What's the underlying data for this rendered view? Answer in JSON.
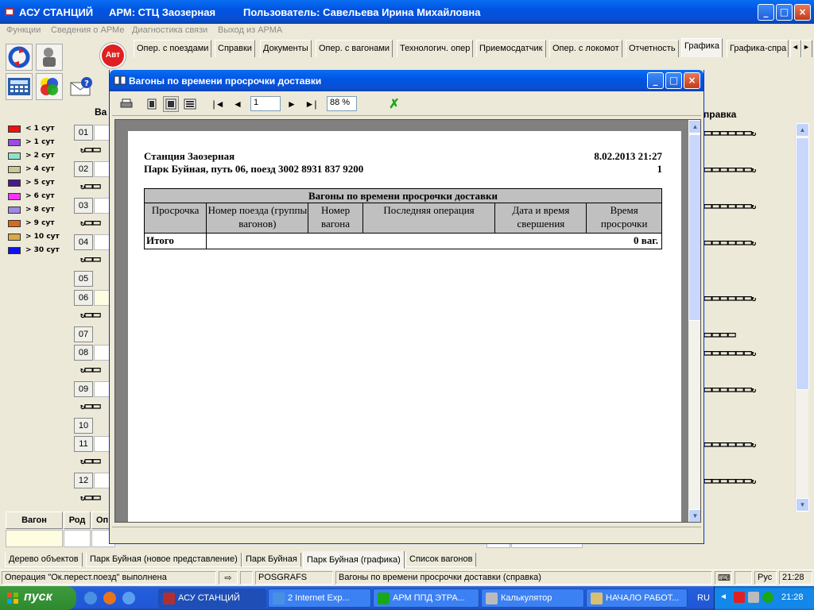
{
  "window": {
    "app_title": "АСУ СТАНЦИЙ",
    "arm_title": "АРМ: СТЦ Заозерная",
    "user_title": "Пользователь: Савельева Ирина Михайловна"
  },
  "menu": [
    "Функции",
    "Сведения о АРМе",
    "Диагностика связи",
    "Выход из АРМА"
  ],
  "tabs": [
    "Опер. с поездами",
    "Справки",
    "Документы",
    "Опер. с вагонами",
    "Технологич. опер",
    "Приемосдатчик",
    "Опер. с локомот",
    "Отчетность",
    "Графика",
    "Графика-спра"
  ],
  "tabs_active": "Графика",
  "icon_avt": "Авт",
  "legend": [
    {
      "label": "< 1 сут",
      "color": "#ee1111"
    },
    {
      "label": "> 1 сут",
      "color": "#9a4be0"
    },
    {
      "label": "> 2 сут",
      "color": "#8fe3c8"
    },
    {
      "label": "> 4 сут",
      "color": "#c8c890"
    },
    {
      "label": "> 5 сут",
      "color": "#4b1a8a"
    },
    {
      "label": "> 6 сут",
      "color": "#ff33ff"
    },
    {
      "label": "> 8 сут",
      "color": "#9a8ae0"
    },
    {
      "label": "> 9 сут",
      "color": "#d86a1a"
    },
    {
      "label": "> 10 сут",
      "color": "#d8a84a"
    },
    {
      "label": "> 30 сут",
      "color": "#1010ee"
    }
  ],
  "tracks": [
    "01",
    "02",
    "03",
    "04",
    "05",
    "06",
    "07",
    "08",
    "09",
    "10",
    "11",
    "12"
  ],
  "left_header_partial": "Ва",
  "right_header_partial": "правка",
  "bottom_grid": {
    "headers": [
      "Вагон",
      "Род",
      "Оп"
    ]
  },
  "bottom_tabs": [
    "Дерево объектов",
    "Парк Буйная (новое представление)",
    "Парк Буйная",
    "Парк Буйная (графика)",
    "Список вагонов"
  ],
  "bottom_tabs_active": "Парк Буйная (графика)",
  "status": {
    "message": "Операция \"Ок.перест.поезд\" выполнена",
    "module": "POSGRAFS",
    "report": "Вагоны по времени просрочки доставки (справка)",
    "lang": "Рус",
    "time": "21:28"
  },
  "dialog": {
    "title": "Вагоны по времени просрочки доставки",
    "page_value": "1",
    "zoom_value": "88 %",
    "report": {
      "station": "Станция Заозерная",
      "datetime": "8.02.2013 21:27",
      "park_line": "Парк Буйная, путь 06, поезд 3002  8931 837 9200",
      "page_no": "1",
      "table_title": "Вагоны по времени просрочки доставки",
      "columns": [
        "Просрочка",
        "Номер поезда (группы вагонов)",
        "Номер вагона",
        "Последняя операция",
        "Дата и время свершения",
        "Время просрочки"
      ],
      "total_label": "Итого",
      "total_value": "0 ваг."
    }
  },
  "taskbar": {
    "start_label": "пуск",
    "items": [
      "АСУ СТАНЦИЙ",
      "2 Internet Exp...",
      "АРМ ППД ЭТРА...",
      "Калькулятор",
      "НАЧАЛО РАБОТ..."
    ],
    "lang": "RU",
    "clock": "21:28"
  }
}
